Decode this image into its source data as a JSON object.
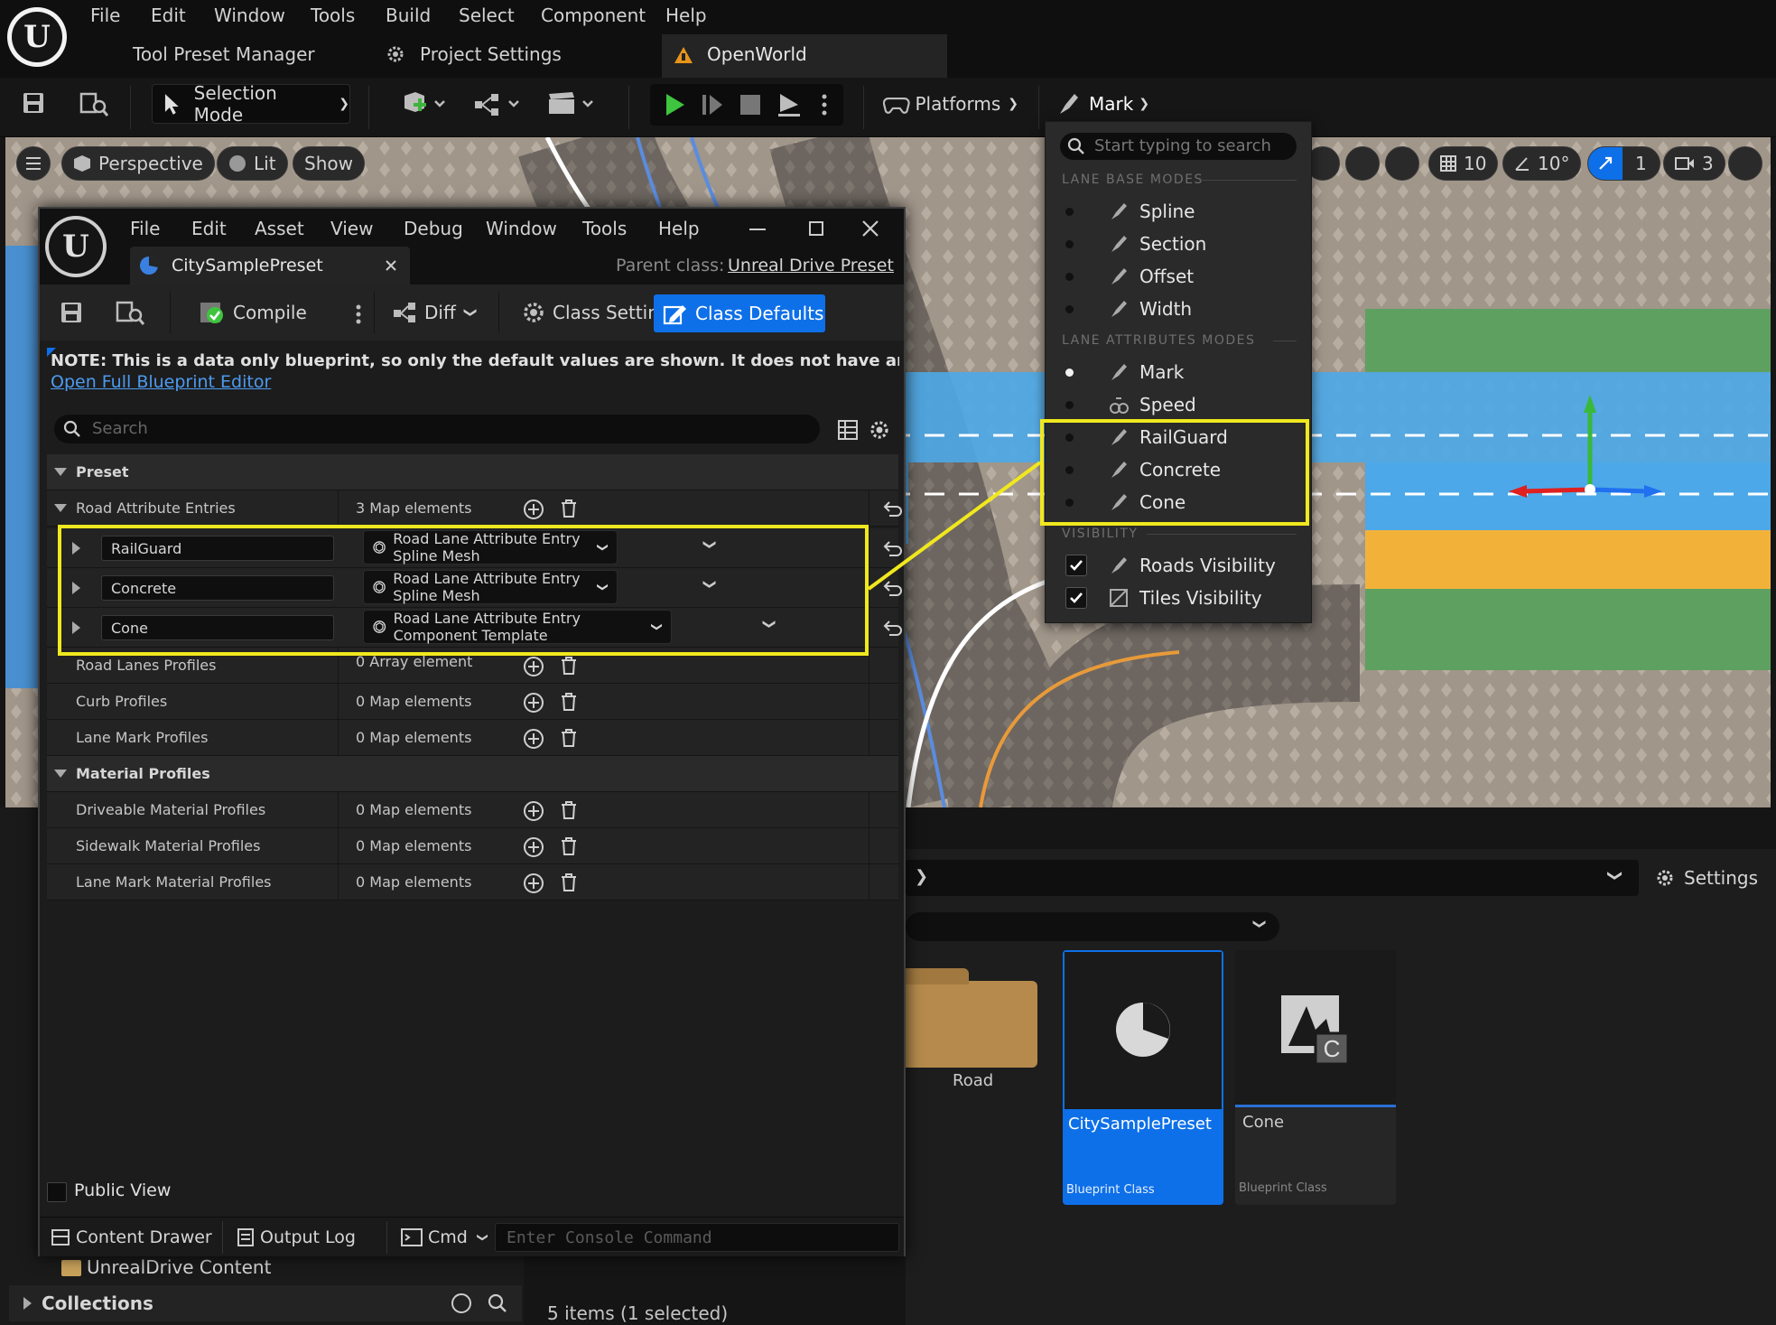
{
  "main_menu": [
    "File",
    "Edit",
    "Window",
    "Tools",
    "Build",
    "Select",
    "Component",
    "Help"
  ],
  "tabs": {
    "tool_preset": "Tool Preset Manager",
    "project_settings": "Project Settings",
    "openworld": "OpenWorld"
  },
  "toolbar": {
    "selection_mode": "Selection Mode",
    "platforms": "Platforms",
    "mark": "Mark"
  },
  "viewport": {
    "perspective": "Perspective",
    "lit": "Lit",
    "show": "Show",
    "grid_snap": "10",
    "rot_snap": "10°",
    "scale_snap": "1",
    "cam_speed": "3"
  },
  "mark_menu": {
    "search_placeholder": "Start typing to search",
    "lane_base_header": "LANE BASE MODES",
    "lane_base": [
      {
        "label": "Spline"
      },
      {
        "label": "Section"
      },
      {
        "label": "Offset"
      },
      {
        "label": "Width"
      }
    ],
    "lane_attr_header": "LANE ATTRIBUTES MODES",
    "lane_attr": [
      {
        "label": "Mark",
        "active": true
      },
      {
        "label": "Speed"
      },
      {
        "label": "RailGuard"
      },
      {
        "label": "Concrete"
      },
      {
        "label": "Cone"
      }
    ],
    "visibility_header": "VISIBILITY",
    "visibility": [
      {
        "label": "Roads Visibility",
        "checked": true
      },
      {
        "label": "Tiles Visibility",
        "checked": true
      }
    ]
  },
  "blueprint": {
    "menu": [
      "File",
      "Edit",
      "Asset",
      "View",
      "Debug",
      "Window",
      "Tools",
      "Help"
    ],
    "tab": "CitySamplePreset",
    "parent_label": "Parent class:",
    "parent_value": "Unreal Drive Preset",
    "compile": "Compile",
    "diff": "Diff",
    "class_settings": "Class Settings",
    "class_defaults": "Class Defaults",
    "note": "NOTE: This is a data only blueprint, so only the default values are shown.  It does not have any script or va",
    "open_full": "Open Full Blueprint Editor",
    "search_placeholder": "Search",
    "preset_section": "Preset",
    "road_attr_entries": {
      "label": "Road Attribute Entries",
      "value": "3 Map elements"
    },
    "entries": [
      {
        "key": "RailGuard",
        "type": "Road Lane Attribute Entry Spline Mesh"
      },
      {
        "key": "Concrete",
        "type": "Road Lane Attribute Entry Spline Mesh"
      },
      {
        "key": "Cone",
        "type": "Road Lane Attribute Entry Component Template"
      }
    ],
    "rows": [
      {
        "label": "Road Lanes Profiles",
        "value": "0 Array element"
      },
      {
        "label": "Curb Profiles",
        "value": "0 Map elements"
      },
      {
        "label": "Lane Mark Profiles",
        "value": "0 Map elements"
      }
    ],
    "material_section": "Material Profiles",
    "material_rows": [
      {
        "label": "Driveable Material Profiles",
        "value": "0 Map elements"
      },
      {
        "label": "Sidewalk Material Profiles",
        "value": "0 Map elements"
      },
      {
        "label": "Lane Mark Material Profiles",
        "value": "0 Map elements"
      }
    ],
    "public_view": "Public View"
  },
  "bottom_bar": {
    "content_drawer": "Content Drawer",
    "output_log": "Output Log",
    "cmd": "Cmd",
    "console_placeholder": "Enter Console Command"
  },
  "content_browser": {
    "settings": "Settings",
    "unreal_drive_content": "UnrealDrive Content",
    "collections": "Collections",
    "status": "5 items (1 selected)",
    "assets": [
      {
        "name": "Road",
        "kind": ""
      },
      {
        "name": "CitySamplePreset",
        "kind": "Blueprint Class"
      },
      {
        "name": "Cone",
        "kind": "Blueprint Class"
      }
    ]
  },
  "colors": {
    "accent": "#0e70e8",
    "highlight": "#f0e81e",
    "panel": "#1c1c1c"
  }
}
